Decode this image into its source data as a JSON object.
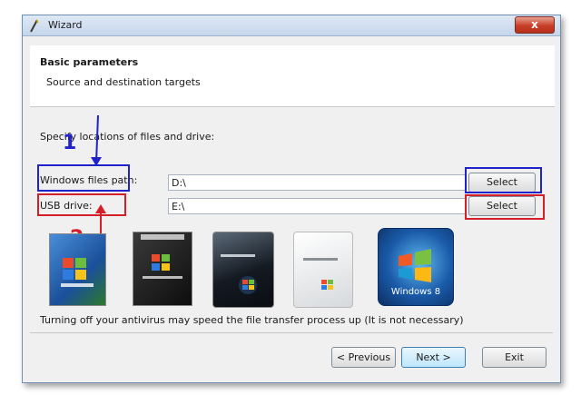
{
  "window": {
    "title": "Wizard",
    "close_glyph": "x"
  },
  "header": {
    "title": "Basic parameters",
    "subtitle": "Source and destination targets"
  },
  "main": {
    "prompt": "Specify locations of files and drive:",
    "windows_path": {
      "label": "Windows files path:",
      "value": "D:\\",
      "button": "Select"
    },
    "usb_drive": {
      "label": "USB drive:",
      "value": "E:\\",
      "button": "Select"
    },
    "annotations": {
      "marker_1": "1",
      "marker_2": "2"
    },
    "images": [
      "windows-xp-box",
      "windows-server-box",
      "windows-vista-box",
      "windows-server-white-box",
      "windows-8-box"
    ],
    "windows8_caption": "Windows 8",
    "note": "Turning off your antivirus may speed the file transfer process up (It is not necessary)"
  },
  "buttons": {
    "previous": "< Previous",
    "next": "Next >",
    "exit": "Exit"
  },
  "colors": {
    "annotation_blue": "#1f23c9",
    "annotation_red": "#d41f2b"
  }
}
